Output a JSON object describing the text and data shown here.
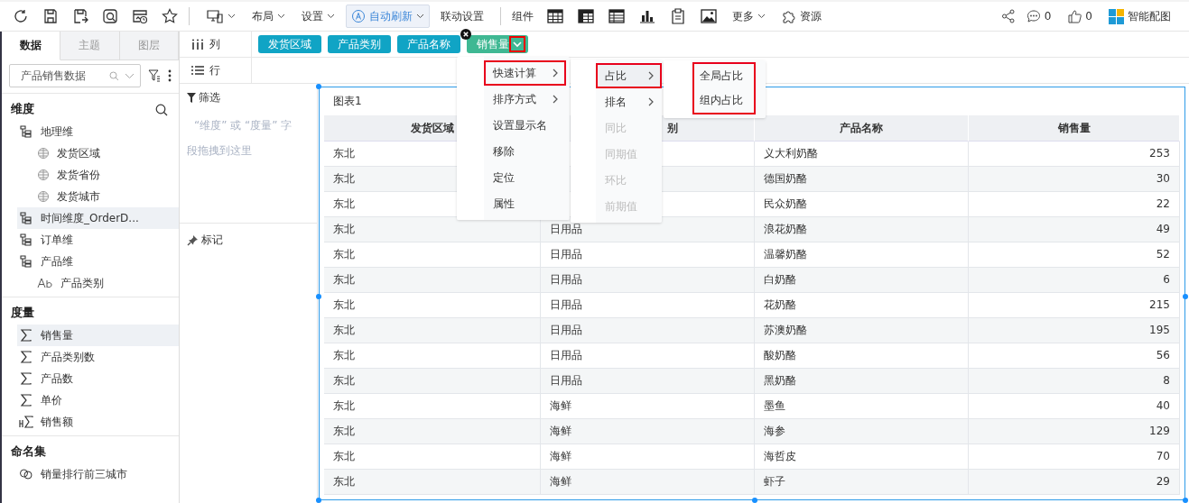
{
  "toolbar": {
    "items": [
      {
        "kind": "device"
      },
      {
        "kind": "menu",
        "label": "布局"
      },
      {
        "kind": "menu",
        "label": "设置"
      },
      {
        "kind": "toggle",
        "label": "自动刷新"
      },
      {
        "kind": "plain",
        "label": "联动设置"
      }
    ],
    "components_label": "组件",
    "more": "更多",
    "resources": "资源",
    "comments": "0",
    "likes": "0",
    "smart": "智能配图"
  },
  "sidebar": {
    "tabs": [
      {
        "label": "数据",
        "selected": true
      },
      {
        "label": "主题",
        "selected": false
      },
      {
        "label": "图层",
        "selected": false
      }
    ],
    "dataset": "产品销售数据",
    "dimensions": {
      "title": "维度",
      "items": [
        {
          "label": "地理维",
          "kind": "hierarchy",
          "selected": false,
          "children": [
            {
              "label": "发货区域",
              "kind": "geo",
              "selected": false
            },
            {
              "label": "发货省份",
              "kind": "geo",
              "selected": false
            },
            {
              "label": "发货城市",
              "kind": "geo",
              "selected": false
            }
          ]
        },
        {
          "label": "时间维度_OrderD...",
          "kind": "hierarchy",
          "selected": true
        },
        {
          "label": "订单维",
          "kind": "hierarchy",
          "selected": false
        },
        {
          "label": "产品维",
          "kind": "hierarchy",
          "selected": false,
          "children": [
            {
              "label": "产品类别",
              "kind": "text",
              "selected": false
            }
          ]
        }
      ]
    },
    "measures": {
      "title": "度量",
      "items": [
        {
          "label": "销售量",
          "kind": "sum",
          "selected": true
        },
        {
          "label": "产品类别数",
          "kind": "sum",
          "selected": false
        },
        {
          "label": "产品数",
          "kind": "sum",
          "selected": false
        },
        {
          "label": "单价",
          "kind": "sum",
          "selected": false
        },
        {
          "label": "销售额",
          "kind": "calc",
          "selected": false
        }
      ]
    },
    "named_sets": {
      "title": "命名集",
      "items": [
        {
          "label": "销量排行前三城市"
        }
      ]
    }
  },
  "shelves": {
    "columns_label": "列",
    "rows_label": "行",
    "pills": [
      {
        "label": "发货区域",
        "kind": "dimension"
      },
      {
        "label": "产品类别",
        "kind": "dimension"
      },
      {
        "label": "产品名称",
        "kind": "dimension"
      },
      {
        "label": "销售量",
        "kind": "measure"
      }
    ],
    "filter_title": "筛选",
    "filter_hint": "“维度” 或 “度量” 字段拖拽到这里",
    "marks_title": "标记"
  },
  "chart": {
    "title": "图表1",
    "columns": [
      {
        "label": "发货区域"
      },
      {
        "label": "别"
      },
      {
        "label": "产品名称"
      },
      {
        "label": "销售量"
      }
    ],
    "rows": [
      {
        "region": "东北",
        "product": "义大利奶酪",
        "sales": "253"
      },
      {
        "region": "东北",
        "product": "德国奶酪",
        "sales": "30"
      },
      {
        "region": "东北",
        "product": "民众奶酪",
        "sales": "22"
      },
      {
        "region": "东北",
        "category": "日用品",
        "product": "浪花奶酪",
        "sales": "49"
      },
      {
        "region": "东北",
        "category": "日用品",
        "product": "温馨奶酪",
        "sales": "52"
      },
      {
        "region": "东北",
        "category": "日用品",
        "product": "白奶酪",
        "sales": "6"
      },
      {
        "region": "东北",
        "category": "日用品",
        "product": "花奶酪",
        "sales": "215"
      },
      {
        "region": "东北",
        "category": "日用品",
        "product": "苏澳奶酪",
        "sales": "195"
      },
      {
        "region": "东北",
        "category": "日用品",
        "product": "酸奶酪",
        "sales": "56"
      },
      {
        "region": "东北",
        "category": "日用品",
        "product": "黑奶酪",
        "sales": "8"
      },
      {
        "region": "东北",
        "category": "海鲜",
        "product": "墨鱼",
        "sales": "40"
      },
      {
        "region": "东北",
        "category": "海鲜",
        "product": "海参",
        "sales": "129"
      },
      {
        "region": "东北",
        "category": "海鲜",
        "product": "海哲皮",
        "sales": "70"
      },
      {
        "region": "东北",
        "category": "海鲜",
        "product": "虾子",
        "sales": "29"
      }
    ]
  },
  "menu": {
    "items": [
      {
        "label": "快速计算",
        "submenu": true,
        "highlighted": true
      },
      {
        "label": "排序方式",
        "submenu": true,
        "highlighted": false
      },
      {
        "label": "设置显示名",
        "submenu": false,
        "highlighted": false
      },
      {
        "label": "移除",
        "submenu": false,
        "highlighted": false
      },
      {
        "label": "定位",
        "submenu": false,
        "highlighted": false
      },
      {
        "label": "属性",
        "submenu": false,
        "highlighted": false
      }
    ],
    "submenu": [
      {
        "label": "占比",
        "submenu": true,
        "highlighted": true,
        "disabled": false
      },
      {
        "label": "排名",
        "submenu": true,
        "highlighted": false,
        "disabled": false
      },
      {
        "label": "同比",
        "submenu": false,
        "highlighted": false,
        "disabled": true
      },
      {
        "label": "同期值",
        "submenu": false,
        "highlighted": false,
        "disabled": true
      },
      {
        "label": "环比",
        "submenu": false,
        "highlighted": false,
        "disabled": true
      },
      {
        "label": "前期值",
        "submenu": false,
        "highlighted": false,
        "disabled": true
      }
    ],
    "third": [
      {
        "label": "全局占比"
      },
      {
        "label": "组内占比"
      }
    ],
    "third_highlighted": true
  }
}
